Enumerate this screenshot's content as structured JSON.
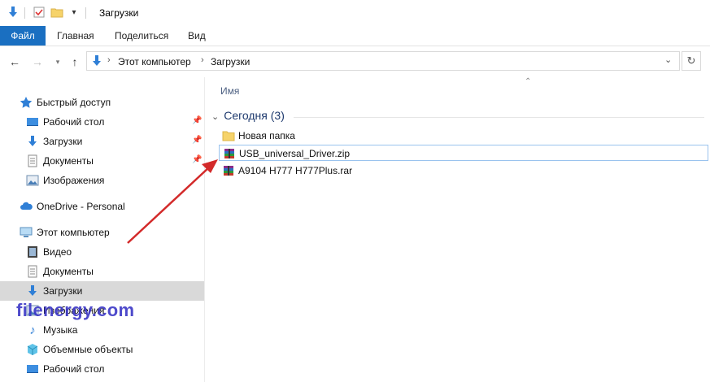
{
  "window": {
    "title": "Загрузки"
  },
  "ribbon": {
    "tabs": [
      "Файл",
      "Главная",
      "Поделиться",
      "Вид"
    ]
  },
  "address": {
    "crumbs": [
      "Этот компьютер",
      "Загрузки"
    ]
  },
  "sidebar": {
    "quick_access": "Быстрый доступ",
    "quick_items": [
      "Рабочий стол",
      "Загрузки",
      "Документы",
      "Изображения"
    ],
    "onedrive": "OneDrive - Personal",
    "this_pc": "Этот компьютер",
    "pc_items": [
      "Видео",
      "Документы",
      "Загрузки",
      "Изображения",
      "Музыка",
      "Объемные объекты",
      "Рабочий стол"
    ]
  },
  "content": {
    "column_name": "Имя",
    "group": "Сегодня (3)",
    "files": [
      {
        "name": "Новая папка",
        "icon": "folder-icon"
      },
      {
        "name": "USB_universal_Driver.zip",
        "icon": "archive-icon"
      },
      {
        "name": "A9104 H777 H777Plus.rar",
        "icon": "archive-icon"
      }
    ]
  },
  "watermark": "filenergy.com",
  "colors": {
    "accent": "#1a6fc1",
    "arrow": "#d32a2a",
    "watermark": "#3b37c6"
  }
}
